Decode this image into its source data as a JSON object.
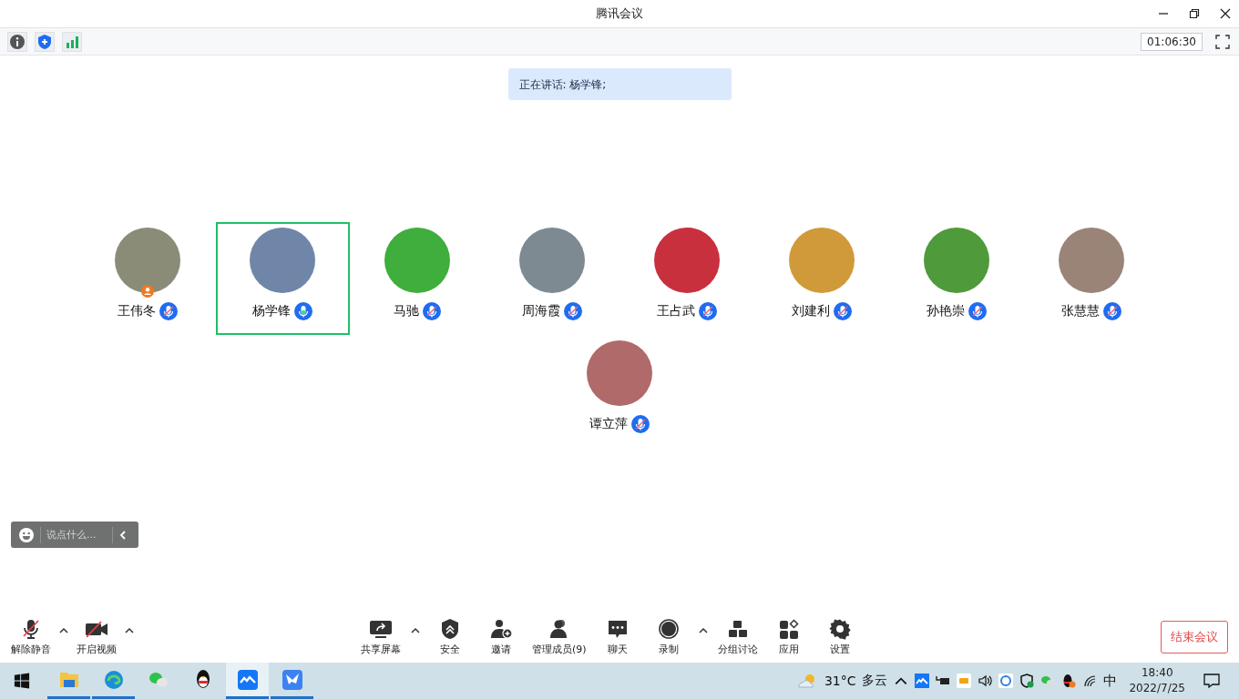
{
  "window": {
    "title": "腾讯会议"
  },
  "info_bar": {
    "timer": "01:06:30"
  },
  "speaking_banner": "正在讲话: 杨学锋;",
  "participants": [
    {
      "name": "王伟冬",
      "selected": false,
      "mic_muted": true,
      "host": true,
      "color": "#8a8c78"
    },
    {
      "name": "杨学锋",
      "selected": true,
      "mic_muted": false,
      "host": false,
      "color": "#6f86a8"
    },
    {
      "name": "马驰",
      "selected": false,
      "mic_muted": true,
      "host": false,
      "color": "#3fae3c"
    },
    {
      "name": "周海霞",
      "selected": false,
      "mic_muted": true,
      "host": false,
      "color": "#7d8a92"
    },
    {
      "name": "王占武",
      "selected": false,
      "mic_muted": true,
      "host": false,
      "color": "#c8303e"
    },
    {
      "name": "刘建利",
      "selected": false,
      "mic_muted": true,
      "host": false,
      "color": "#d09a3a"
    },
    {
      "name": "孙艳崇",
      "selected": false,
      "mic_muted": true,
      "host": false,
      "color": "#4f9a3a"
    },
    {
      "name": "张慧慧",
      "selected": false,
      "mic_muted": true,
      "host": false,
      "color": "#9a8478"
    },
    {
      "name": "谭立萍",
      "selected": false,
      "mic_muted": true,
      "host": false,
      "color": "#b06a6a"
    }
  ],
  "chat_input": {
    "placeholder": "说点什么..."
  },
  "toolbar_left": [
    {
      "kind": "mic_off",
      "label": "解除静音",
      "caret": true
    },
    {
      "kind": "video_off",
      "label": "开启视频",
      "caret": true
    }
  ],
  "toolbar_center": [
    {
      "kind": "share",
      "label": "共享屏幕",
      "caret": true
    },
    {
      "kind": "security",
      "label": "安全",
      "caret": false
    },
    {
      "kind": "invite",
      "label": "邀请",
      "caret": false
    },
    {
      "kind": "members",
      "label": "管理成员(9)",
      "caret": false
    },
    {
      "kind": "chat",
      "label": "聊天",
      "caret": false
    },
    {
      "kind": "record",
      "label": "录制",
      "caret": true
    },
    {
      "kind": "breakout",
      "label": "分组讨论",
      "caret": false
    },
    {
      "kind": "apps",
      "label": "应用",
      "caret": false
    },
    {
      "kind": "settings",
      "label": "设置",
      "caret": false
    }
  ],
  "end_button": "结束会议",
  "taskbar": {
    "apps": [
      {
        "kind": "files",
        "open": true,
        "selected": false
      },
      {
        "kind": "browser",
        "open": true,
        "selected": false
      },
      {
        "kind": "chat",
        "open": false,
        "selected": false
      },
      {
        "kind": "penguin",
        "open": false,
        "selected": false
      },
      {
        "kind": "meeting",
        "open": true,
        "selected": true
      },
      {
        "kind": "bird",
        "open": true,
        "selected": false
      }
    ],
    "temperature": "31°C",
    "weather": "多云",
    "ime": "中",
    "time": "18:40",
    "date": "2022/7/25"
  }
}
